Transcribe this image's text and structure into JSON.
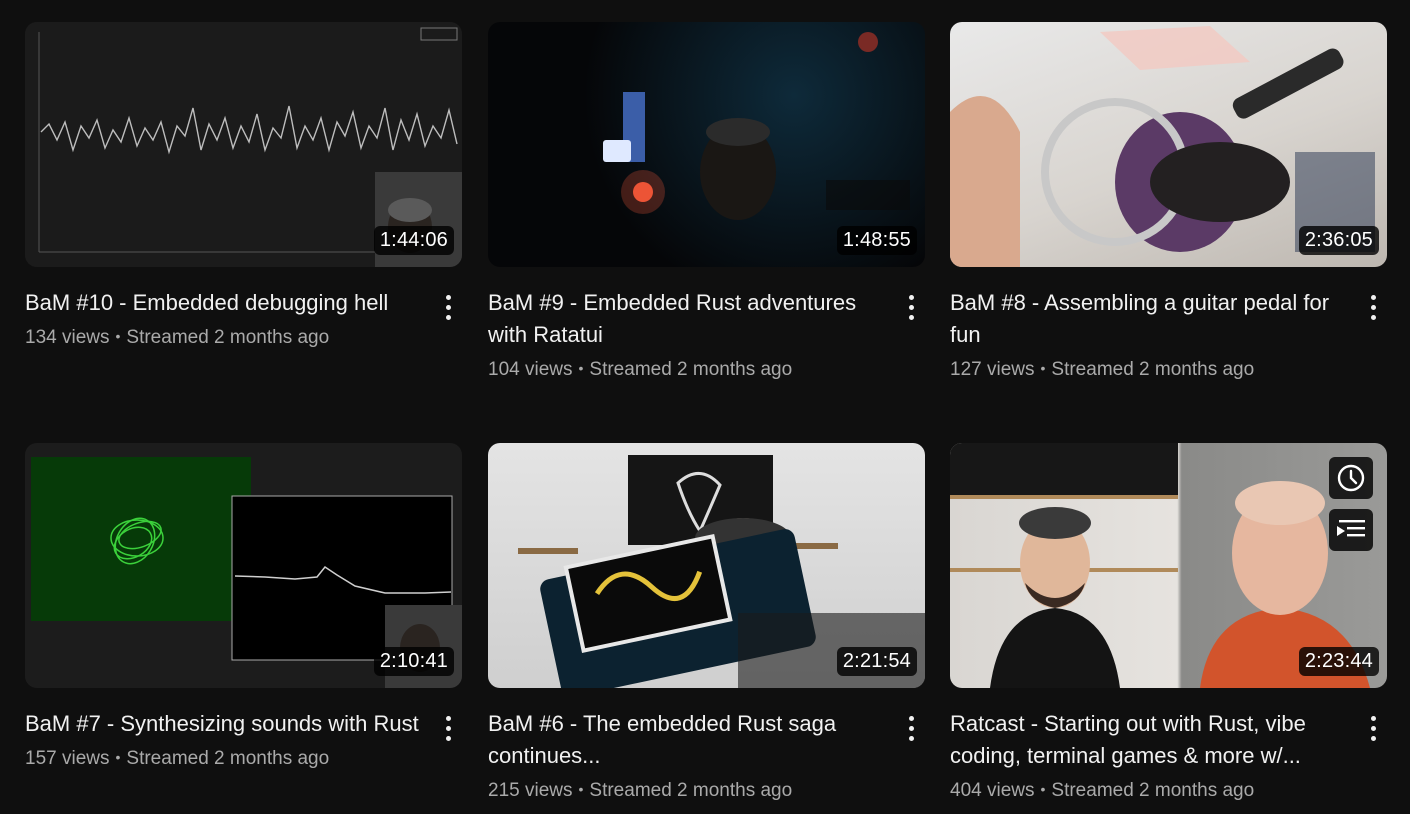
{
  "videos": [
    {
      "title": "BaM #10 - Embedded debugging hell",
      "views": "134 views",
      "streamed": "Streamed 2 months ago",
      "duration": "1:44:06"
    },
    {
      "title": "BaM #9 - Embedded Rust adventures with Ratatui",
      "views": "104 views",
      "streamed": "Streamed 2 months ago",
      "duration": "1:48:55"
    },
    {
      "title": "BaM #8 - Assembling a guitar pedal for fun",
      "views": "127 views",
      "streamed": "Streamed 2 months ago",
      "duration": "2:36:05"
    },
    {
      "title": "BaM #7 - Synthesizing sounds with Rust",
      "views": "157 views",
      "streamed": "Streamed 2 months ago",
      "duration": "2:10:41"
    },
    {
      "title": "BaM #6 - The embedded Rust saga continues...",
      "views": "215 views",
      "streamed": "Streamed 2 months ago",
      "duration": "2:21:54"
    },
    {
      "title": "Ratcast - Starting out with Rust, vibe coding, terminal games & more w/...",
      "views": "404 views",
      "streamed": "Streamed 2 months ago",
      "duration": "2:23:44"
    }
  ],
  "separator": "•",
  "icons": {
    "more": "more-vert-icon",
    "watch_later": "clock-icon",
    "add_to_queue": "add-to-queue-icon"
  },
  "colors": {
    "background": "#0f0f0f",
    "title": "#f1f1f1",
    "meta": "#aaaaaa"
  }
}
